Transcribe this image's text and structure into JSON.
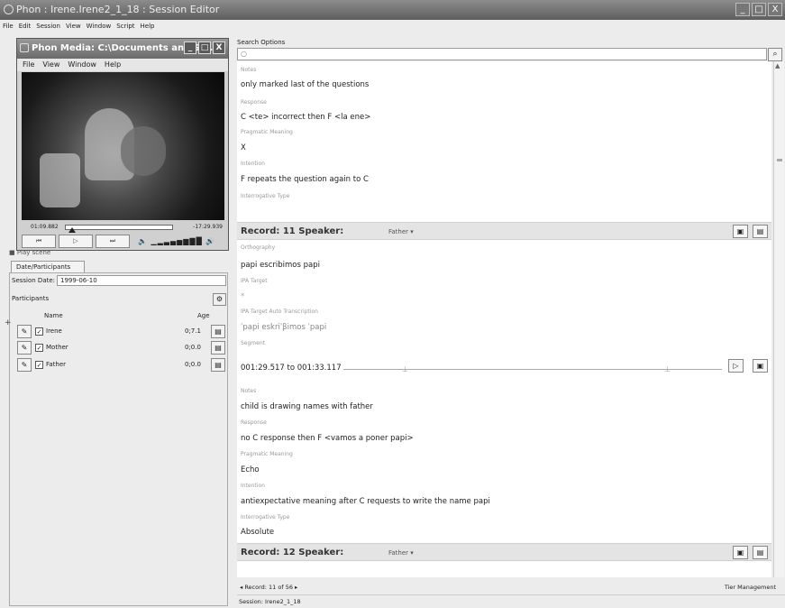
{
  "window": {
    "title": "Phon : Irene.Irene2_1_18 : Session Editor",
    "buttons": [
      "_",
      "□",
      "X"
    ]
  },
  "menubar": [
    "File",
    "Edit",
    "Session",
    "View",
    "Window",
    "Script",
    "Help"
  ],
  "media": {
    "title": "Phon Media: C:\\Documents and Se...",
    "buttons": [
      "_",
      "□",
      "X"
    ],
    "menu": [
      "File",
      "View",
      "Window",
      "Help"
    ],
    "time_start": "01:09.882",
    "time_end": "-17:29.939",
    "controls": [
      "⏮",
      "▷",
      "⏭"
    ],
    "volume": "🔈 ▁▂▃▄▅▆▇█ 🔊",
    "playhead_fraction": 0.07
  },
  "left": {
    "play_scene": "■ Play scene",
    "tab": "Date/Participants",
    "session_date_label": "Session Date:",
    "session_date_value": "1999-06-10",
    "participants_label": "Participants",
    "col_name": "Name",
    "col_age": "Age",
    "participants": [
      {
        "name": "Irene",
        "age": "0;7.1",
        "checked": "✓"
      },
      {
        "name": "Mother",
        "age": "0;0.0",
        "checked": "✓"
      },
      {
        "name": "Father",
        "age": "0;0.0",
        "checked": "✓"
      }
    ]
  },
  "search": {
    "label": "Search Options",
    "placeholder": ""
  },
  "editor": {
    "top_tiers": [
      {
        "label": "Notes",
        "value": "only marked last of the questions"
      },
      {
        "label": "Response",
        "value": "C <te> incorrect then F <la ene>"
      },
      {
        "label": "Pragmatic Meaning",
        "value": "X"
      },
      {
        "label": "Intention",
        "value": "F repeats the question again to C"
      },
      {
        "label": "Interrogative Type",
        "value": ""
      }
    ],
    "record11": {
      "title": "Record: 11  Speaker:",
      "speaker": "Father ▾",
      "tiers": [
        {
          "label": "Orthography",
          "value": "papi escribimos papi"
        },
        {
          "label": "IPA Target",
          "value": "*"
        },
        {
          "label": "IPA Target Auto Transcription",
          "value": "ˈpapi eskriˈβimos ˈpapi"
        },
        {
          "label": "Segment",
          "value": "001:29.517 to 001:33.117"
        },
        {
          "label": "Notes",
          "value": "child is drawing names with father"
        },
        {
          "label": "Response",
          "value": "no C response then F <vamos a poner papi>"
        },
        {
          "label": "Pragmatic Meaning",
          "value": "Echo"
        },
        {
          "label": "Intention",
          "value": "antiexpectative meaning after C requests to write the name papi"
        },
        {
          "label": "Interrogative Type",
          "value": "Absolute"
        }
      ]
    },
    "record12": {
      "title": "Record: 12  Speaker:",
      "speaker": "Father ▾"
    }
  },
  "nav": {
    "text": "◂  Record: 11   of 56  ▸",
    "tier_management": "Tier Management"
  },
  "status": "Session: Irene2_1_18"
}
